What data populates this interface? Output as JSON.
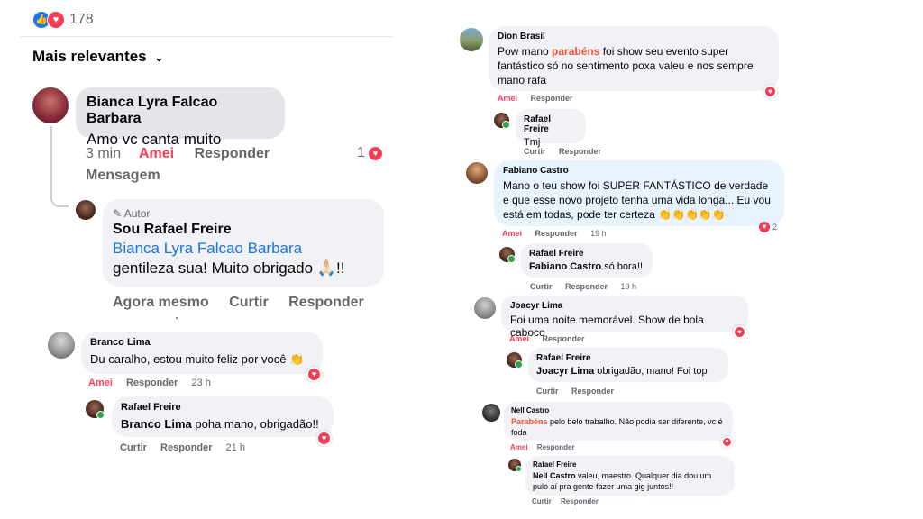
{
  "reactions": {
    "count": "178",
    "icons": [
      "like-icon",
      "love-icon"
    ]
  },
  "sort": {
    "label": "Mais relevantes"
  },
  "colors": {
    "love": "#f33e58",
    "link": "#1b74e4",
    "bubble": "#f0f2f5",
    "highlight": "#f0533a"
  },
  "left": {
    "bianca": {
      "name": "Bianca Lyra Falcao Barbara",
      "text": "Amo vc canta muito",
      "time": "3 min",
      "loved": "Amei",
      "reply": "Responder",
      "message": "Mensagem",
      "reaction_count": "1"
    },
    "author_reply": {
      "badge": "Autor",
      "name": "Sou Rafael Freire",
      "mention": "Bianca Lyra Falcao Barbara",
      "text": "gentileza sua! Muito obrigado 🙏🏻!!",
      "time": "Agora mesmo",
      "like": "Curtir",
      "reply": "Responder"
    },
    "branco": {
      "name": "Branco Lima",
      "text": "Du caralho, estou muito feliz por você 👏",
      "loved": "Amei",
      "reply": "Responder",
      "time": "23 h"
    },
    "rafael_branco": {
      "name": "Rafael Freire",
      "mention": "Branco Lima",
      "text": " poha mano, obrigadão!!",
      "like": "Curtir",
      "reply": "Responder",
      "time": "21 h"
    }
  },
  "right": {
    "dion": {
      "name": "Dion Brasil",
      "pre": "Pow mano ",
      "hl": "parabéns",
      "text": " foi show seu evento super fantástico só no sentimento poxa valeu e nos sempre mano rafa",
      "loved": "Amei",
      "reply": "Responder"
    },
    "rafael_dion": {
      "name": "Rafael Freire",
      "text": "Tmj",
      "like": "Curtir",
      "reply": "Responder"
    },
    "fabiano": {
      "name": "Fabiano Castro",
      "text": "Mano o teu show foi SUPER FANTÁSTICO de verdade e que esse novo projeto tenha uma vida longa... Eu vou está em todas, pode ter certeza 👏👏👏👏👏",
      "loved": "Amei",
      "reply": "Responder",
      "time": "19 h",
      "reaction_count": "2"
    },
    "rafael_fabiano": {
      "name": "Rafael Freire",
      "mention": "Fabiano Castro",
      "text": " só bora!!",
      "like": "Curtir",
      "reply": "Responder",
      "time": "19 h"
    },
    "joacyr": {
      "name": "Joacyr Lima",
      "text": "Foi uma noite memorável. Show de bola caboco",
      "loved": "Amei",
      "reply": "Responder"
    },
    "rafael_joacyr": {
      "name": "Rafael Freire",
      "mention": "Joacyr Lima",
      "text": " obrigadão, mano! Foi top",
      "like": "Curtir",
      "reply": "Responder"
    },
    "nell": {
      "name": "Nell Castro",
      "hl": "Parabéns",
      "text": " pelo belo trabalho. Não podia ser diferente, vc é foda",
      "loved": "Amei",
      "reply": "Responder"
    },
    "rafael_nell": {
      "name": "Rafael Freire",
      "mention": "Nell Castro",
      "text": " valeu, maestro. Qualquer dia dou um pulo aí pra gente fazer uma gig juntos!!",
      "like": "Curtir",
      "reply": "Responder"
    }
  }
}
